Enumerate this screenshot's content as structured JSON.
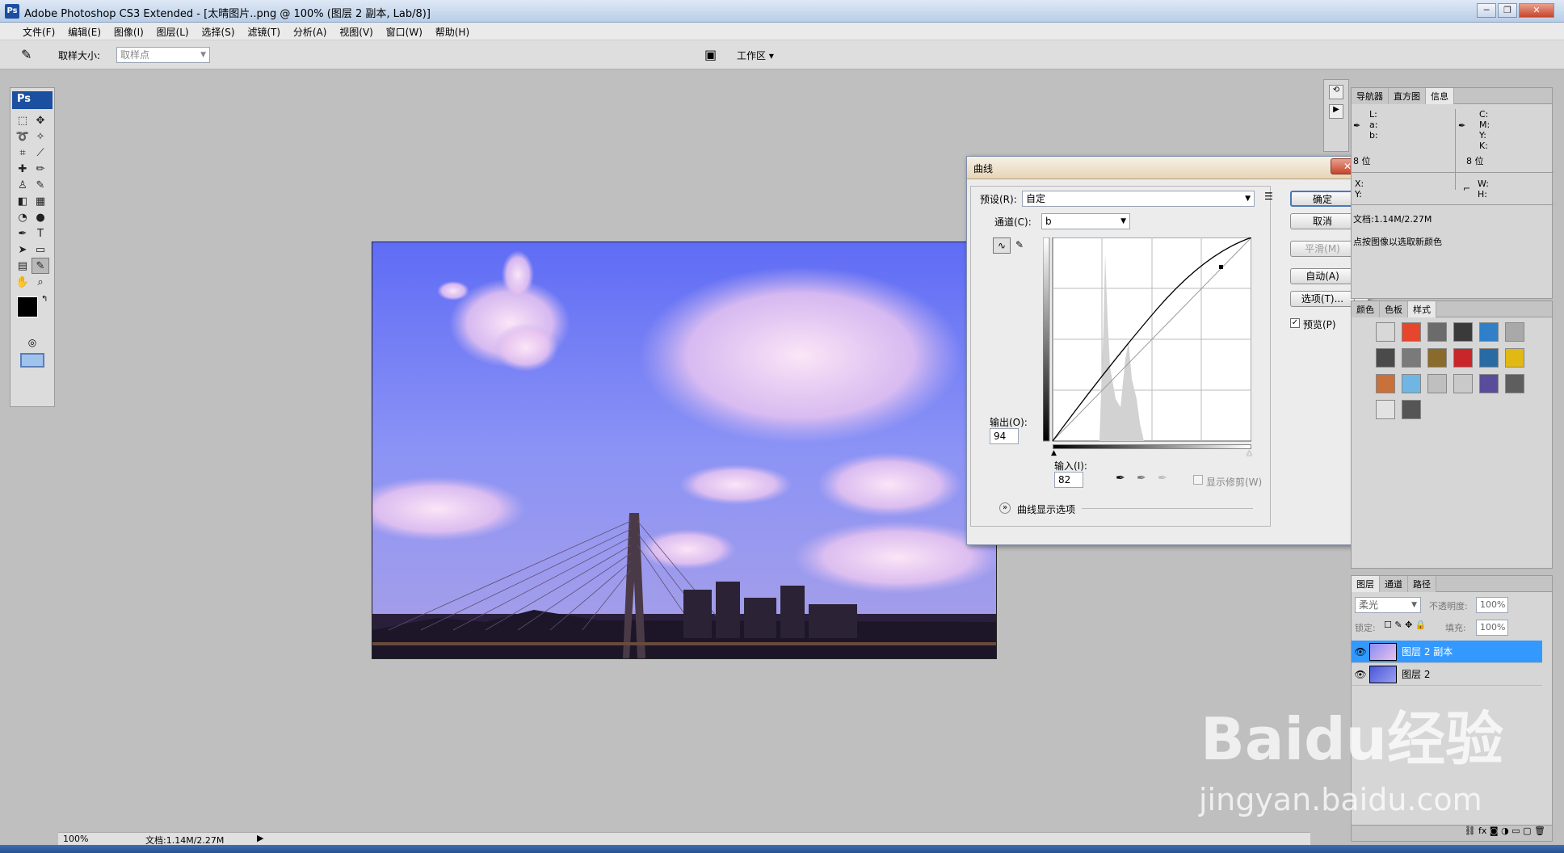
{
  "window": {
    "title": "Adobe Photoshop CS3 Extended - [太晴图片..png @ 100% (图层 2 副本, Lab/8)]",
    "min": "─",
    "restore": "❐",
    "close": "✕"
  },
  "menu": [
    "文件(F)",
    "编辑(E)",
    "图像(I)",
    "图层(L)",
    "选择(S)",
    "滤镜(T)",
    "分析(A)",
    "视图(V)",
    "窗口(W)",
    "帮助(H)"
  ],
  "options": {
    "sample_size_label": "取样大小:",
    "sample_size_value": "取样点",
    "workspace_label": "工作区 ▾"
  },
  "toolbox": {
    "ps_logo": "Ps"
  },
  "dialog": {
    "title": "曲线",
    "preset_label": "预设(R):",
    "preset_value": "自定",
    "channel_label": "通道(C):",
    "channel_value": "b",
    "output_label": "输出(O):",
    "output_value": "94",
    "input_label": "输入(I):",
    "input_value": "82",
    "show_clipping": "显示修剪(W)",
    "display_options": "曲线显示选项",
    "buttons": {
      "ok": "确定",
      "cancel": "取消",
      "smooth": "平滑(M)",
      "auto": "自动(A)",
      "options": "选项(T)..."
    },
    "preview_label": "预览(P)",
    "preview_checked": true
  },
  "info_panel": {
    "tabs": [
      "导航器",
      "直方图",
      "信息"
    ],
    "lab": [
      "L:",
      "a:",
      "b:"
    ],
    "cmyk": [
      "C:",
      "M:",
      "Y:",
      "K:"
    ],
    "bits_left": "8 位",
    "bits_right": "8 位",
    "xy": [
      "X:",
      "Y:"
    ],
    "wh": [
      "W:",
      "H:"
    ],
    "doc": "文档:1.14M/2.27M",
    "hint": "点按图像以选取新颜色"
  },
  "styles_panel": {
    "tabs": [
      "颜色",
      "色板",
      "样式"
    ],
    "swatch_colors": [
      "#d8d8d8",
      "#e5462c",
      "#6b6b6b",
      "#3a3a3a",
      "#2f7fc9",
      "#a9a9a9",
      "#4a4a4a",
      "#7a7a7a",
      "#8a6b2b",
      "#c9262b",
      "#2a6aa3",
      "#e2b813",
      "#c9713a",
      "#6fb6e3",
      "#bfbfbf",
      "#c9c9c9",
      "#5a4c9a",
      "#5e5e5e",
      "#e2e2e2",
      "#555555"
    ]
  },
  "layers_panel": {
    "tabs": [
      "图层",
      "通道",
      "路径"
    ],
    "blend_mode": "柔光",
    "opacity_label": "不透明度:",
    "opacity_value": "100%",
    "lock_label": "锁定:",
    "fill_label": "填充:",
    "fill_value": "100%",
    "layers": [
      {
        "name": "图层 2 副本",
        "selected": true
      },
      {
        "name": "图层 2",
        "selected": false
      }
    ]
  },
  "status": {
    "zoom": "100%",
    "doc": "文档:1.14M/2.27M"
  },
  "watermark": {
    "text1": "Baidu经验",
    "text2": "jingyan.baidu.com"
  },
  "colors": {
    "selected_layer": "#3399ff",
    "ps_blue": "#1b4fa0"
  }
}
